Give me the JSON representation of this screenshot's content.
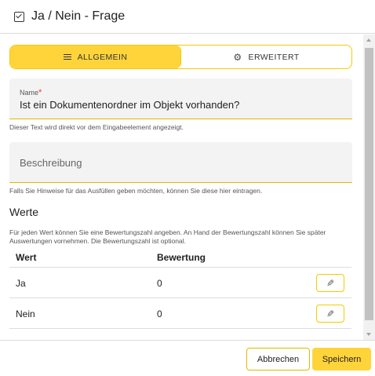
{
  "dialog": {
    "title": "Ja / Nein - Frage",
    "title_icon": "checkbox-icon"
  },
  "tabs": [
    {
      "label": "ALLGEMEIN",
      "icon": "list-icon",
      "active": true
    },
    {
      "label": "ERWEITERT",
      "icon": "gear-icon",
      "active": false
    }
  ],
  "name_field": {
    "label": "Name",
    "required_mark": "*",
    "value": "Ist ein Dokumentenordner im Objekt vorhanden?",
    "hint": "Dieser Text wird direkt vor dem Eingabeelement angezeigt."
  },
  "description_field": {
    "placeholder": "Beschreibung",
    "hint": "Falls Sie Hinweise für das Ausfüllen geben möchten, können Sie diese hier eintragen."
  },
  "values_section": {
    "title": "Werte",
    "hint": "Für jeden Wert können Sie eine Bewertungszahl angeben. An Hand der Bewertungszahl können Sie später Auswertungen vornehmen. Die Bewertungszahl ist optional.",
    "columns": [
      "Wert",
      "Bewertung"
    ],
    "rows": [
      {
        "wert": "Ja",
        "bewertung": "0"
      },
      {
        "wert": "Nein",
        "bewertung": "0"
      }
    ]
  },
  "footer": {
    "cancel_label": "Abbrechen",
    "save_label": "Speichern"
  },
  "colors": {
    "accent": "#ffd43b",
    "accent_border": "#f7c900",
    "required": "#e53935"
  }
}
